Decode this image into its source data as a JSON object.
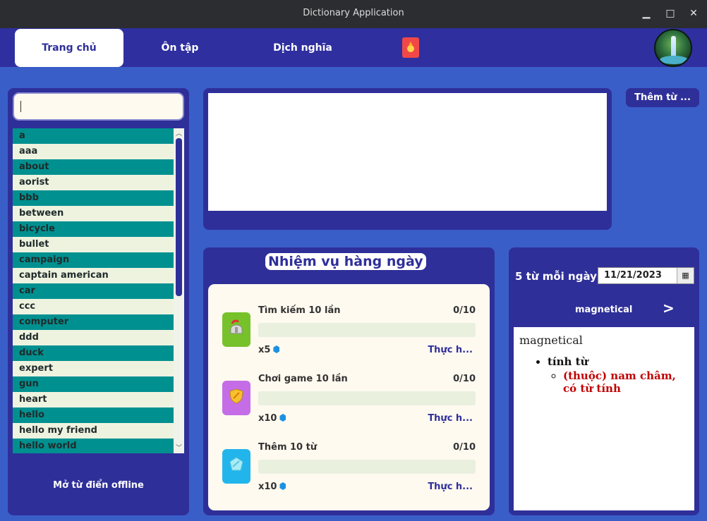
{
  "window": {
    "title": "Dictionary Application",
    "minimize": "▁",
    "maximize": "□",
    "close": "✕"
  },
  "nav": {
    "tabs": [
      {
        "label": "Trang chủ",
        "active": true
      },
      {
        "label": "Ôn tập",
        "active": false
      },
      {
        "label": "Dịch nghĩa",
        "active": false
      }
    ],
    "game_icon": "game-icon",
    "avatar_icon": "avatar-waterfall"
  },
  "search": {
    "value": "",
    "placeholder": ""
  },
  "words": [
    "a",
    "aaa",
    "about",
    "aorist",
    "bbb",
    "between",
    "bicycle",
    "bullet",
    "campaign",
    "captain american",
    "car",
    "ccc",
    "computer",
    "ddd",
    "duck",
    "expert",
    "gun",
    "heart",
    "hello",
    "hello my friend",
    "hello world"
  ],
  "offline_button": "Mở từ điển offline",
  "add_word_button": "Thêm từ ...",
  "missions": {
    "title": "Nhiệm vụ hàng ngày",
    "items": [
      {
        "name": "Tìm kiếm 10 lần",
        "progress": "0/10",
        "fraction": 0,
        "reward": "x5",
        "action": "Thực h...",
        "icon": "helmet-icon",
        "color": "#77c22b"
      },
      {
        "name": "Chơi game 10 lần",
        "progress": "0/10",
        "fraction": 0,
        "reward": "x10",
        "action": "Thực h...",
        "icon": "shield-icon",
        "color": "#c46de6"
      },
      {
        "name": "Thêm 10 từ",
        "progress": "0/10",
        "fraction": 0,
        "reward": "x10",
        "action": "Thực h...",
        "icon": "crystal-icon",
        "color": "#22b5ec"
      }
    ]
  },
  "daily_words": {
    "label": "5 từ mỗi ngày",
    "date": "11/21/2023",
    "current_word": "magnetical",
    "next": ">",
    "definition": {
      "word": "magnetical",
      "part_of_speech": "tính từ",
      "meaning": "(thuộc) nam châm, có từ tính"
    }
  },
  "colors": {
    "primary": "#2f2f9a",
    "background": "#3a5ec8",
    "list_alt": "#009090",
    "list_base": "#eef3e0"
  }
}
